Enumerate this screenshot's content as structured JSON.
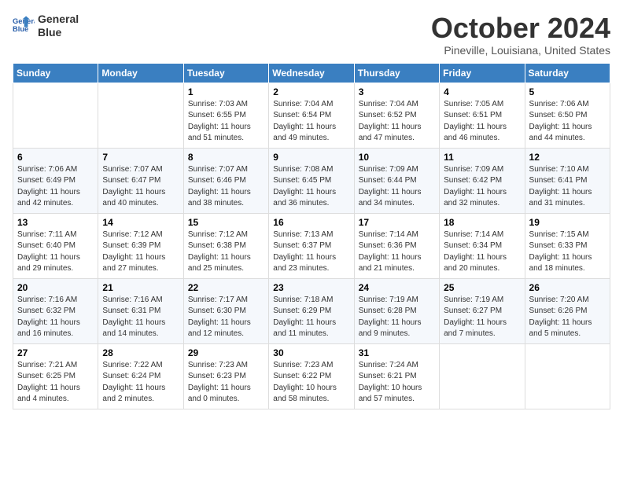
{
  "header": {
    "logo_line1": "General",
    "logo_line2": "Blue",
    "month": "October 2024",
    "location": "Pineville, Louisiana, United States"
  },
  "weekdays": [
    "Sunday",
    "Monday",
    "Tuesday",
    "Wednesday",
    "Thursday",
    "Friday",
    "Saturday"
  ],
  "weeks": [
    [
      {
        "day": "",
        "info": ""
      },
      {
        "day": "",
        "info": ""
      },
      {
        "day": "1",
        "info": "Sunrise: 7:03 AM\nSunset: 6:55 PM\nDaylight: 11 hours and 51 minutes."
      },
      {
        "day": "2",
        "info": "Sunrise: 7:04 AM\nSunset: 6:54 PM\nDaylight: 11 hours and 49 minutes."
      },
      {
        "day": "3",
        "info": "Sunrise: 7:04 AM\nSunset: 6:52 PM\nDaylight: 11 hours and 47 minutes."
      },
      {
        "day": "4",
        "info": "Sunrise: 7:05 AM\nSunset: 6:51 PM\nDaylight: 11 hours and 46 minutes."
      },
      {
        "day": "5",
        "info": "Sunrise: 7:06 AM\nSunset: 6:50 PM\nDaylight: 11 hours and 44 minutes."
      }
    ],
    [
      {
        "day": "6",
        "info": "Sunrise: 7:06 AM\nSunset: 6:49 PM\nDaylight: 11 hours and 42 minutes."
      },
      {
        "day": "7",
        "info": "Sunrise: 7:07 AM\nSunset: 6:47 PM\nDaylight: 11 hours and 40 minutes."
      },
      {
        "day": "8",
        "info": "Sunrise: 7:07 AM\nSunset: 6:46 PM\nDaylight: 11 hours and 38 minutes."
      },
      {
        "day": "9",
        "info": "Sunrise: 7:08 AM\nSunset: 6:45 PM\nDaylight: 11 hours and 36 minutes."
      },
      {
        "day": "10",
        "info": "Sunrise: 7:09 AM\nSunset: 6:44 PM\nDaylight: 11 hours and 34 minutes."
      },
      {
        "day": "11",
        "info": "Sunrise: 7:09 AM\nSunset: 6:42 PM\nDaylight: 11 hours and 32 minutes."
      },
      {
        "day": "12",
        "info": "Sunrise: 7:10 AM\nSunset: 6:41 PM\nDaylight: 11 hours and 31 minutes."
      }
    ],
    [
      {
        "day": "13",
        "info": "Sunrise: 7:11 AM\nSunset: 6:40 PM\nDaylight: 11 hours and 29 minutes."
      },
      {
        "day": "14",
        "info": "Sunrise: 7:12 AM\nSunset: 6:39 PM\nDaylight: 11 hours and 27 minutes."
      },
      {
        "day": "15",
        "info": "Sunrise: 7:12 AM\nSunset: 6:38 PM\nDaylight: 11 hours and 25 minutes."
      },
      {
        "day": "16",
        "info": "Sunrise: 7:13 AM\nSunset: 6:37 PM\nDaylight: 11 hours and 23 minutes."
      },
      {
        "day": "17",
        "info": "Sunrise: 7:14 AM\nSunset: 6:36 PM\nDaylight: 11 hours and 21 minutes."
      },
      {
        "day": "18",
        "info": "Sunrise: 7:14 AM\nSunset: 6:34 PM\nDaylight: 11 hours and 20 minutes."
      },
      {
        "day": "19",
        "info": "Sunrise: 7:15 AM\nSunset: 6:33 PM\nDaylight: 11 hours and 18 minutes."
      }
    ],
    [
      {
        "day": "20",
        "info": "Sunrise: 7:16 AM\nSunset: 6:32 PM\nDaylight: 11 hours and 16 minutes."
      },
      {
        "day": "21",
        "info": "Sunrise: 7:16 AM\nSunset: 6:31 PM\nDaylight: 11 hours and 14 minutes."
      },
      {
        "day": "22",
        "info": "Sunrise: 7:17 AM\nSunset: 6:30 PM\nDaylight: 11 hours and 12 minutes."
      },
      {
        "day": "23",
        "info": "Sunrise: 7:18 AM\nSunset: 6:29 PM\nDaylight: 11 hours and 11 minutes."
      },
      {
        "day": "24",
        "info": "Sunrise: 7:19 AM\nSunset: 6:28 PM\nDaylight: 11 hours and 9 minutes."
      },
      {
        "day": "25",
        "info": "Sunrise: 7:19 AM\nSunset: 6:27 PM\nDaylight: 11 hours and 7 minutes."
      },
      {
        "day": "26",
        "info": "Sunrise: 7:20 AM\nSunset: 6:26 PM\nDaylight: 11 hours and 5 minutes."
      }
    ],
    [
      {
        "day": "27",
        "info": "Sunrise: 7:21 AM\nSunset: 6:25 PM\nDaylight: 11 hours and 4 minutes."
      },
      {
        "day": "28",
        "info": "Sunrise: 7:22 AM\nSunset: 6:24 PM\nDaylight: 11 hours and 2 minutes."
      },
      {
        "day": "29",
        "info": "Sunrise: 7:23 AM\nSunset: 6:23 PM\nDaylight: 11 hours and 0 minutes."
      },
      {
        "day": "30",
        "info": "Sunrise: 7:23 AM\nSunset: 6:22 PM\nDaylight: 10 hours and 58 minutes."
      },
      {
        "day": "31",
        "info": "Sunrise: 7:24 AM\nSunset: 6:21 PM\nDaylight: 10 hours and 57 minutes."
      },
      {
        "day": "",
        "info": ""
      },
      {
        "day": "",
        "info": ""
      }
    ]
  ]
}
